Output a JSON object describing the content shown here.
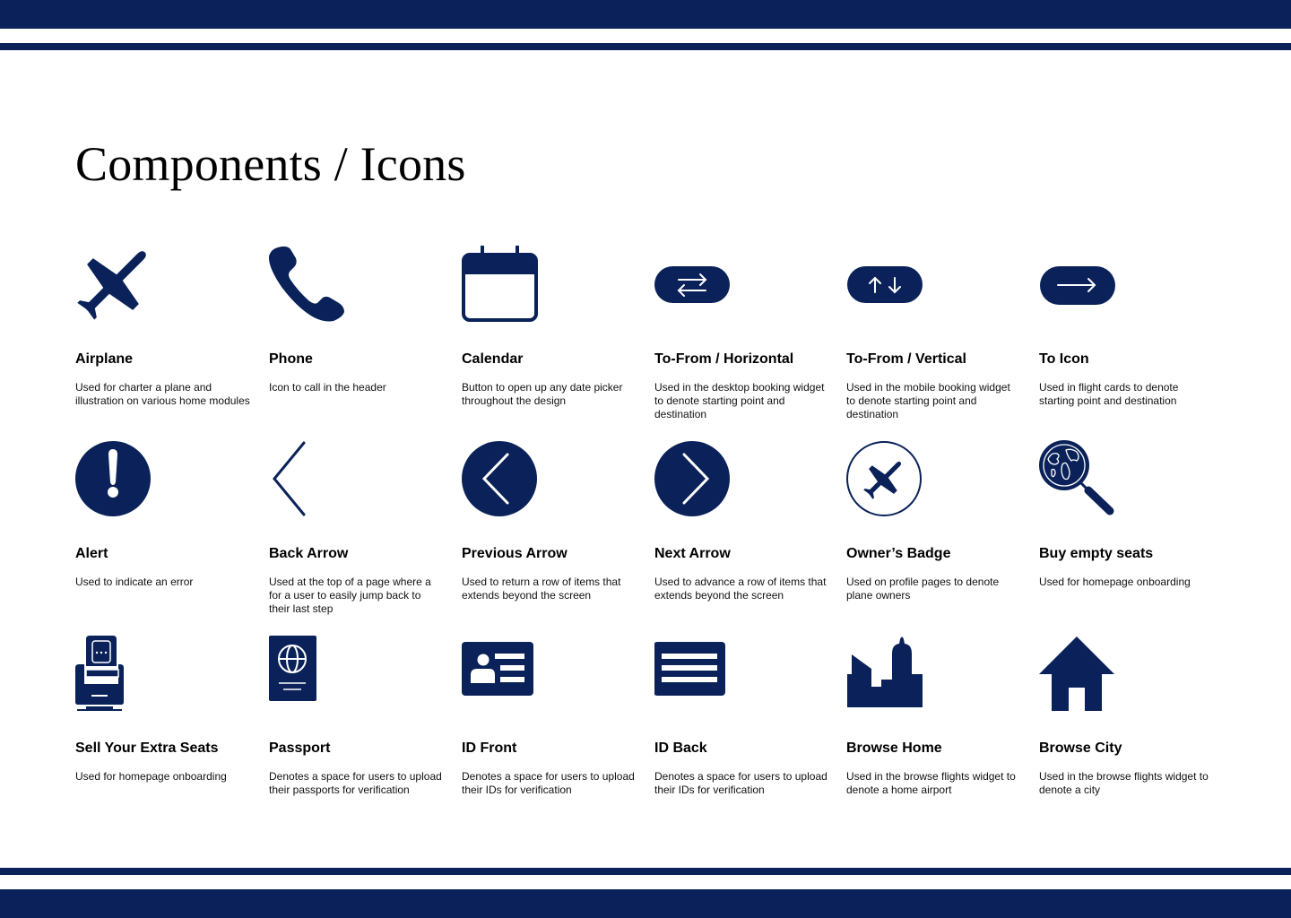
{
  "page": {
    "title": "Components / Icons",
    "brand_color": "#0a2259"
  },
  "icons": [
    {
      "name": "Airplane",
      "description": "Used for charter a plane and illustration on various home modules",
      "icon": "airplane-icon"
    },
    {
      "name": "Phone",
      "description": "Icon to call in the header",
      "icon": "phone-icon"
    },
    {
      "name": "Calendar",
      "description": "Button to open up any date picker throughout the design",
      "icon": "calendar-icon"
    },
    {
      "name": "To-From / Horizontal",
      "description": "Used in the desktop booking widget to denote starting point and destination",
      "icon": "swap-horizontal-icon"
    },
    {
      "name": "To-From / Vertical",
      "description": "Used in the mobile booking widget to denote starting point and destination",
      "icon": "swap-vertical-icon"
    },
    {
      "name": "To Icon",
      "description": "Used in flight cards to denote starting point and destination",
      "icon": "arrow-right-icon"
    },
    {
      "name": "Alert",
      "description": "Used to indicate an error",
      "icon": "alert-icon"
    },
    {
      "name": "Back Arrow",
      "description": "Used at the top of a page where a for a user to easily jump back to their last step",
      "icon": "back-arrow-icon"
    },
    {
      "name": "Previous Arrow",
      "description": "Used to return a row of items that extends beyond the screen",
      "icon": "previous-arrow-icon"
    },
    {
      "name": "Next Arrow",
      "description": "Used to advance a row of items that extends beyond the screen",
      "icon": "next-arrow-icon"
    },
    {
      "name": "Owner’s Badge",
      "description": "Used on profile pages to denote plane owners",
      "icon": "owner-badge-icon"
    },
    {
      "name": "Buy empty seats",
      "description": "Used for homepage onboarding",
      "icon": "globe-search-icon"
    },
    {
      "name": "Sell Your Extra Seats",
      "description": "Used for homepage onboarding",
      "icon": "seat-icon"
    },
    {
      "name": "Passport",
      "description": "Denotes a space for users to upload their passports for verification",
      "icon": "passport-icon"
    },
    {
      "name": "ID Front",
      "description": "Denotes a space for users to upload their IDs for verification",
      "icon": "id-front-icon"
    },
    {
      "name": "ID Back",
      "description": "Denotes a space for users to upload their IDs for verification",
      "icon": "id-back-icon"
    },
    {
      "name": "Browse Home",
      "description": "Used in the browse flights widget to denote a home airport",
      "icon": "city-skyline-icon"
    },
    {
      "name": "Browse City",
      "description": "Used in the browse flights widget to denote a city",
      "icon": "house-icon"
    }
  ]
}
